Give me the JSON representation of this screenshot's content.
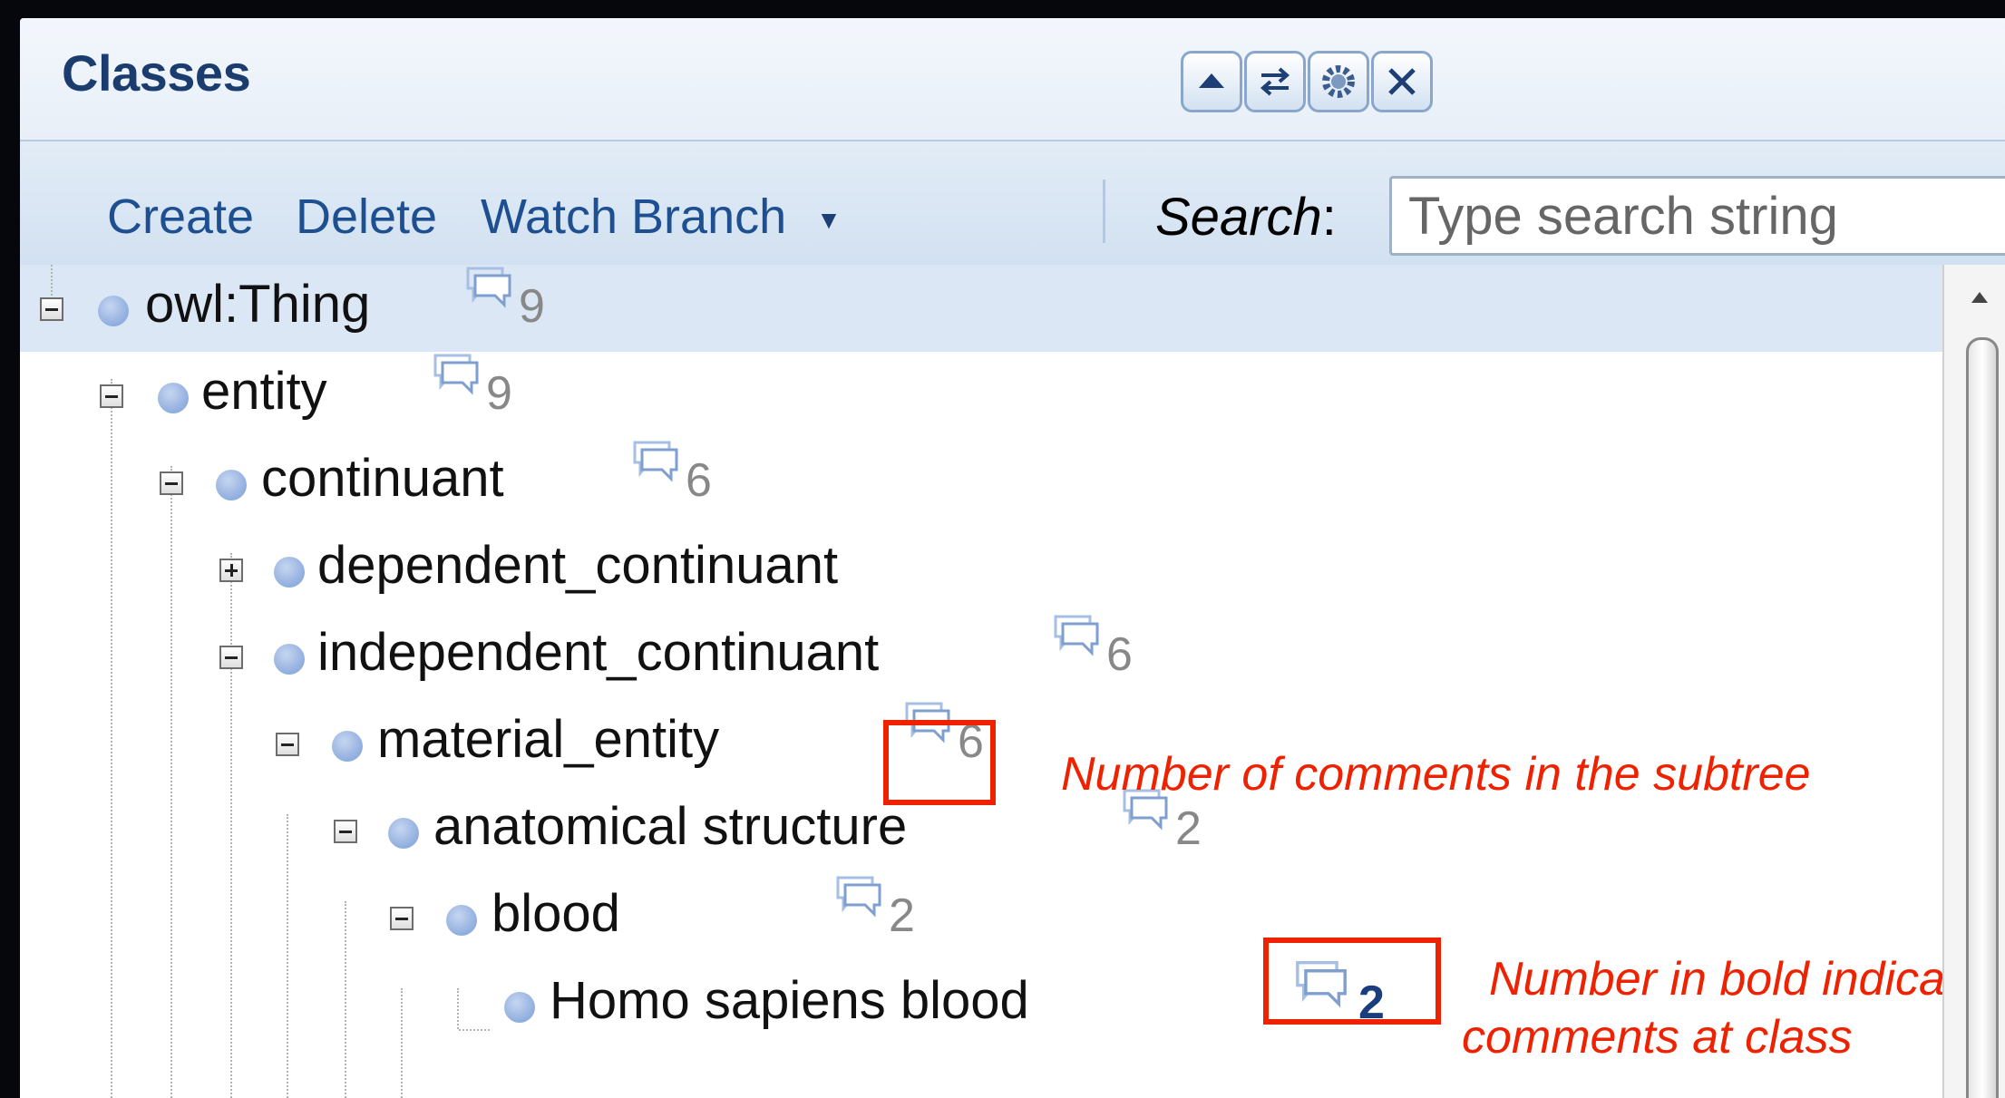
{
  "panel": {
    "title": "Classes"
  },
  "header_tools": [
    {
      "icon": "collapse-up-icon",
      "glyph": "▲"
    },
    {
      "icon": "swap-icon",
      "glyph": "⇄"
    },
    {
      "icon": "gear-icon",
      "glyph": "⚙"
    },
    {
      "icon": "close-icon",
      "glyph": "✕"
    }
  ],
  "toolbar": {
    "create_label": "Create",
    "delete_label": "Delete",
    "watch_branch_label": "Watch Branch",
    "watch_branch_arrow": "▼",
    "search_label": "Search",
    "search_colon": ":",
    "search_placeholder": "Type search string"
  },
  "tree": {
    "rows": [
      {
        "label": "owl:Thing",
        "count": "9",
        "expanded": true
      },
      {
        "label": "entity",
        "count": "9",
        "expanded": true
      },
      {
        "label": "continuant",
        "count": "6",
        "expanded": true
      },
      {
        "label": "dependent_continuant",
        "count": "",
        "expanded": false
      },
      {
        "label": "independent_continuant",
        "count": "6",
        "expanded": true
      },
      {
        "label": "material_entity",
        "count": "6",
        "expanded": true
      },
      {
        "label": "anatomical structure",
        "count": "2",
        "expanded": true
      },
      {
        "label": "blood",
        "count": "2",
        "expanded": true
      },
      {
        "label": "Homo sapiens blood",
        "count": "2",
        "expanded": null
      }
    ]
  },
  "annotations": {
    "subtree_note": "Number of comments in the subtree",
    "class_note_line1": "Number in bold indicates",
    "class_note_line2": "comments at class"
  },
  "colors": {
    "annotation_red": "#ee2200",
    "title_blue": "#1b3c6e",
    "link_blue": "#1d4f91",
    "node_blue": "#8fadde"
  }
}
